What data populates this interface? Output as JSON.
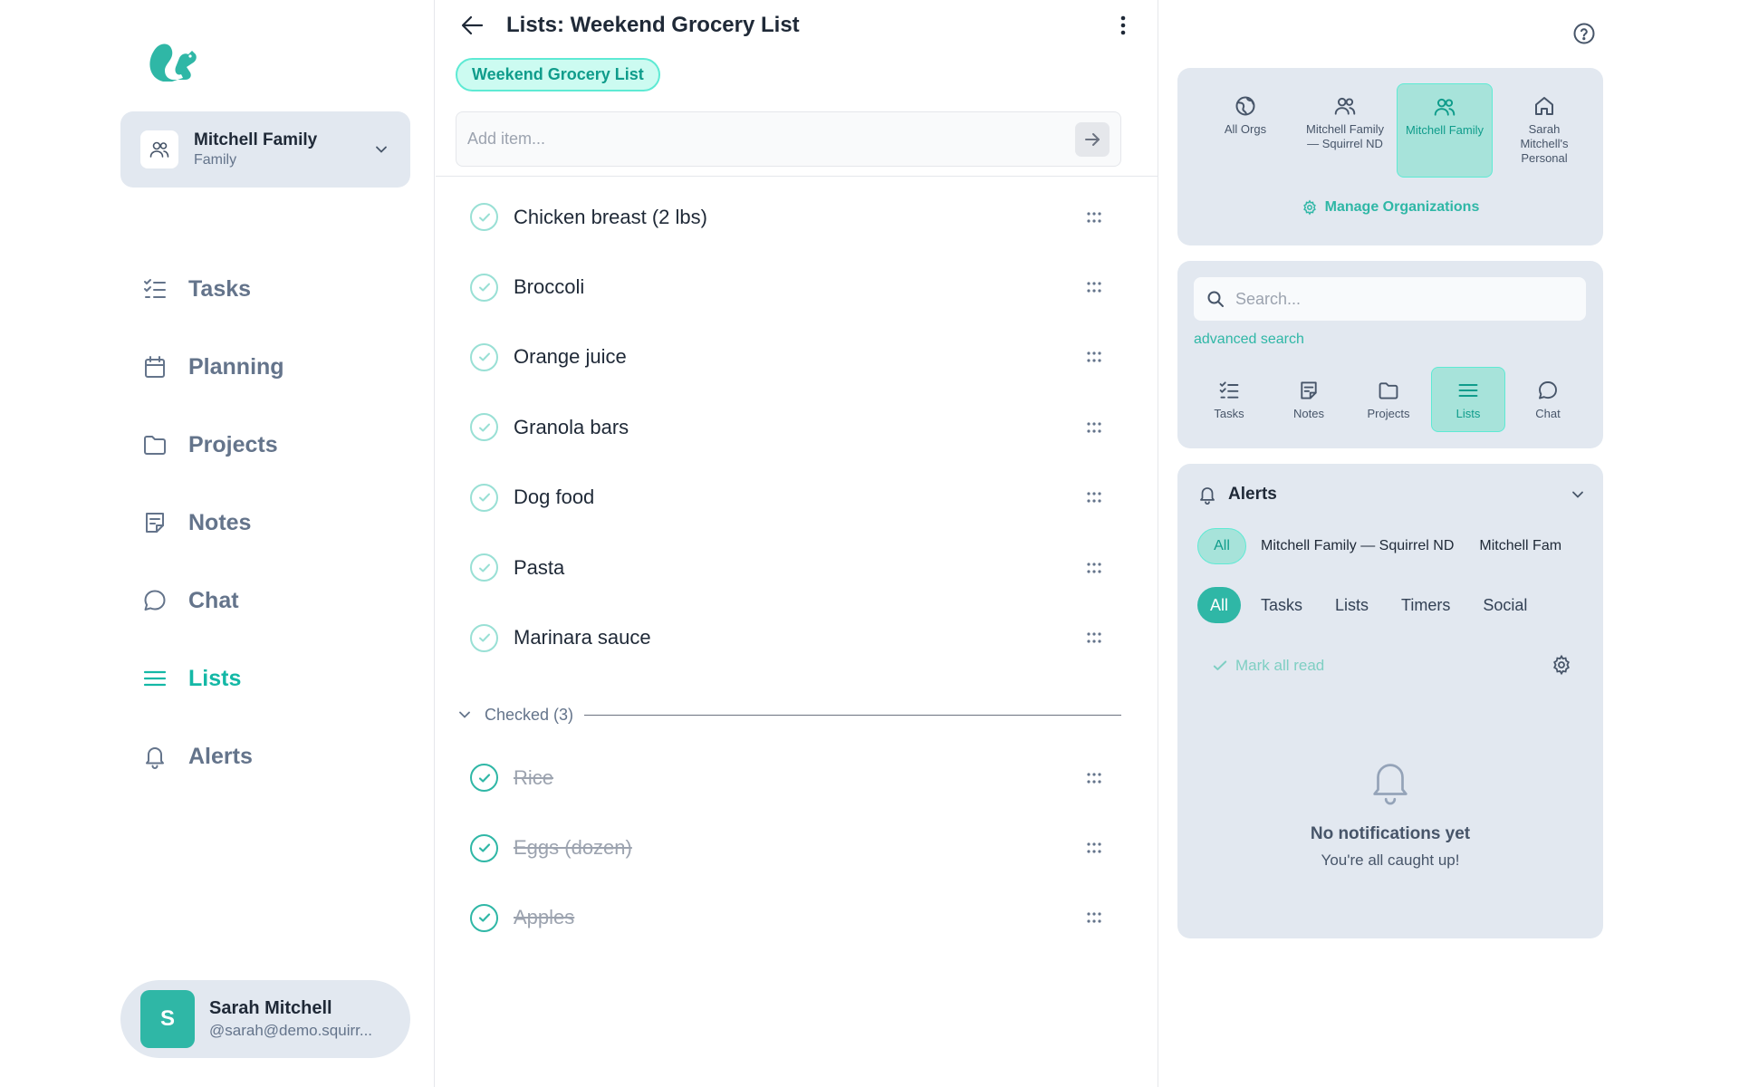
{
  "sidebar": {
    "org": {
      "name": "Mitchell Family",
      "type": "Family"
    },
    "nav": [
      {
        "label": "Tasks",
        "icon": "tasks-icon"
      },
      {
        "label": "Planning",
        "icon": "calendar-icon"
      },
      {
        "label": "Projects",
        "icon": "folder-icon"
      },
      {
        "label": "Notes",
        "icon": "note-icon"
      },
      {
        "label": "Chat",
        "icon": "chat-icon"
      },
      {
        "label": "Lists",
        "icon": "list-icon",
        "active": true
      },
      {
        "label": "Alerts",
        "icon": "bell-icon"
      }
    ],
    "user": {
      "initial": "S",
      "name": "Sarah Mitchell",
      "handle": "@sarah@demo.squirr..."
    }
  },
  "main": {
    "title": "Lists: Weekend Grocery List",
    "chip": "Weekend Grocery List",
    "add_placeholder": "Add item...",
    "items": [
      "Chicken breast (2 lbs)",
      "Broccoli",
      "Orange juice",
      "Granola bars",
      "Dog food",
      "Pasta",
      "Marinara sauce"
    ],
    "checked_label": "Checked (3)",
    "checked_items": [
      "Rice",
      "Eggs (dozen)",
      "Apples"
    ]
  },
  "right": {
    "org_tabs": [
      {
        "label": "All Orgs",
        "icon": "globe-icon"
      },
      {
        "label": "Mitchell Family — Squirrel ND",
        "icon": "users-icon"
      },
      {
        "label": "Mitchell Family",
        "icon": "users-icon",
        "active": true
      },
      {
        "label": "Sarah Mitchell's Personal",
        "icon": "home-icon"
      }
    ],
    "manage_orgs": "Manage Organizations",
    "search_placeholder": "Search...",
    "advanced_search": "advanced search",
    "type_tabs": [
      {
        "label": "Tasks",
        "icon": "tasks-icon"
      },
      {
        "label": "Notes",
        "icon": "note-icon"
      },
      {
        "label": "Projects",
        "icon": "folder-icon"
      },
      {
        "label": "Lists",
        "icon": "list-icon",
        "active": true
      },
      {
        "label": "Chat",
        "icon": "chat-icon"
      }
    ],
    "alerts": {
      "title": "Alerts",
      "org_filters": [
        "All",
        "Mitchell Family — Squirrel ND",
        "Mitchell Fam"
      ],
      "categories": [
        "All",
        "Tasks",
        "Lists",
        "Timers",
        "Social"
      ],
      "mark_all_read": "Mark all read",
      "empty_title": "No notifications yet",
      "empty_sub": "You're all caught up!"
    }
  },
  "colors": {
    "accent": "#2fb7a6",
    "accent_light": "#a7e3da",
    "panel": "#e2e8f0",
    "muted": "#64748b"
  }
}
